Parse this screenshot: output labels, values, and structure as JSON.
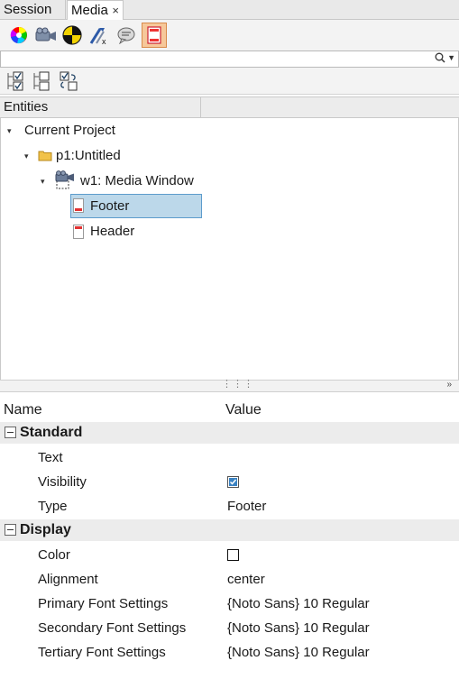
{
  "tabs": [
    {
      "label": "Session"
    },
    {
      "label": "Media",
      "close": "×"
    }
  ],
  "search": {
    "placeholder": "",
    "value": ""
  },
  "tree": {
    "header": "Entities",
    "nodes": [
      {
        "label": "Current Project"
      },
      {
        "label": "p1:Untitled"
      },
      {
        "label": "w1: Media Window"
      },
      {
        "label": "Footer"
      },
      {
        "label": "Header"
      }
    ]
  },
  "properties": {
    "col_name": "Name",
    "col_value": "Value",
    "groups": [
      {
        "label": "Standard",
        "rows": [
          {
            "name": "Text",
            "value": ""
          },
          {
            "name": "Visibility",
            "checked": true
          },
          {
            "name": "Type",
            "value": "Footer"
          }
        ]
      },
      {
        "label": "Display",
        "rows": [
          {
            "name": "Color",
            "color": "#ffffff"
          },
          {
            "name": "Alignment",
            "value": "center"
          },
          {
            "name": "Primary Font Settings",
            "value": "{Noto Sans} 10 Regular"
          },
          {
            "name": "Secondary Font Settings",
            "value": "{Noto Sans} 10 Regular"
          },
          {
            "name": "Tertiary Font Settings",
            "value": "{Noto Sans} 10 Regular"
          }
        ]
      }
    ]
  },
  "colors": {
    "selection": "#bcd8ea",
    "active_tool": "#f6c89a"
  }
}
